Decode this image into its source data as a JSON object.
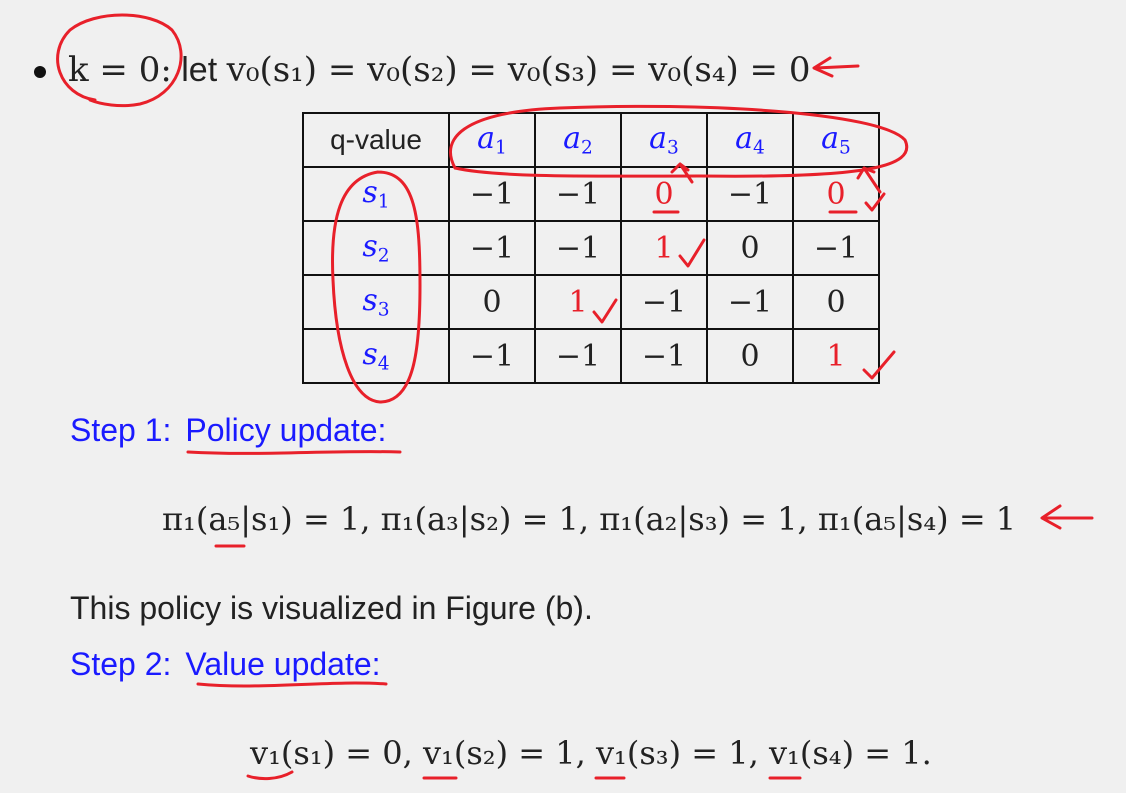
{
  "bullet": {
    "condition": "k = 0:",
    "intro": "let",
    "initial_values": "v₀(s₁) = v₀(s₂) = v₀(s₃) = v₀(s₄) = 0"
  },
  "qtable": {
    "corner_label": "q-value",
    "actions": [
      "a",
      "a",
      "a",
      "a",
      "a"
    ],
    "action_subscripts": [
      "1",
      "2",
      "3",
      "4",
      "5"
    ],
    "states": [
      "s",
      "s",
      "s",
      "s"
    ],
    "state_subscripts": [
      "1",
      "2",
      "3",
      "4"
    ],
    "rows": [
      [
        "−1",
        "−1",
        "0",
        "−1",
        "0"
      ],
      [
        "−1",
        "−1",
        "1",
        "0",
        "−1"
      ],
      [
        "0",
        "1",
        "−1",
        "−1",
        "0"
      ],
      [
        "−1",
        "−1",
        "−1",
        "0",
        "1"
      ]
    ],
    "highlighted_cells": [
      [
        0,
        2
      ],
      [
        0,
        4
      ],
      [
        1,
        2
      ],
      [
        2,
        1
      ],
      [
        3,
        4
      ]
    ]
  },
  "step1": {
    "label": "Step 1:",
    "title": "Policy update:",
    "formula": "π₁(a₅|s₁) = 1, π₁(a₃|s₂) = 1, π₁(a₂|s₃) = 1, π₁(a₅|s₄) = 1"
  },
  "policy_note": "This policy is visualized in Figure (b).",
  "step2": {
    "label": "Step 2:",
    "title": "Value update:",
    "formula": "v₁(s₁) = 0, v₁(s₂) = 1, v₁(s₃) = 1, v₁(s₄) = 1."
  },
  "colors": {
    "background": "#f0f0f0",
    "math_blue": "#1a1aff",
    "annotation_red": "#e8202a",
    "text": "#222222"
  }
}
